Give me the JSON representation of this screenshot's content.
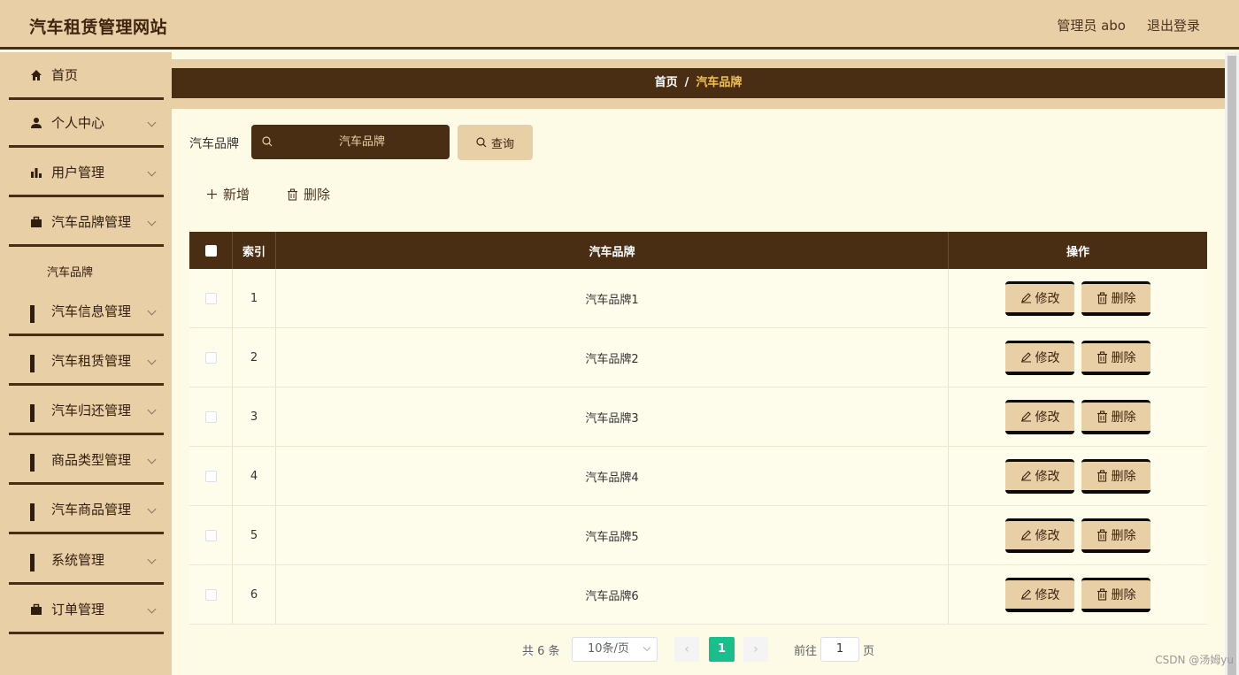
{
  "header": {
    "title": "汽车租赁管理网站",
    "user": "管理员 abo",
    "logout": "退出登录"
  },
  "sidebar": {
    "items": [
      {
        "label": "首页",
        "icon": "home-icon"
      },
      {
        "label": "个人中心",
        "icon": "user-icon"
      },
      {
        "label": "用户管理",
        "icon": "bar-chart-icon"
      },
      {
        "label": "汽车品牌管理",
        "icon": "briefcase-icon"
      },
      {
        "label": "汽车信息管理",
        "icon": "grid-icon"
      },
      {
        "label": "汽车租赁管理",
        "icon": "grid-icon"
      },
      {
        "label": "汽车归还管理",
        "icon": "grid-icon"
      },
      {
        "label": "商品类型管理",
        "icon": "grid-icon"
      },
      {
        "label": "汽车商品管理",
        "icon": "grid-icon"
      },
      {
        "label": "系统管理",
        "icon": "grid-icon"
      },
      {
        "label": "订单管理",
        "icon": "briefcase-icon"
      }
    ],
    "sub_item": "汽车品牌"
  },
  "breadcrumb": {
    "home": "首页",
    "sep": "/",
    "current": "汽车品牌"
  },
  "search": {
    "label": "汽车品牌",
    "placeholder": "汽车品牌",
    "button": "查询"
  },
  "toolbar": {
    "add": "新增",
    "delete": "删除"
  },
  "table": {
    "headers": {
      "index": "索引",
      "brand": "汽车品牌",
      "ops": "操作"
    },
    "rows": [
      {
        "index": "1",
        "brand": "汽车品牌1"
      },
      {
        "index": "2",
        "brand": "汽车品牌2"
      },
      {
        "index": "3",
        "brand": "汽车品牌3"
      },
      {
        "index": "4",
        "brand": "汽车品牌4"
      },
      {
        "index": "5",
        "brand": "汽车品牌5"
      },
      {
        "index": "6",
        "brand": "汽车品牌6"
      }
    ],
    "edit_label": "修改",
    "delete_label": "删除"
  },
  "pagination": {
    "total": "共 6 条",
    "page_size": "10条/页",
    "current": "1",
    "goto_label": "前往",
    "goto_value": "1",
    "page_suffix": "页"
  },
  "watermark": "CSDN @汤姆yu",
  "colors": {
    "accent_dark": "#4a2e14",
    "accent_light": "#e9cfa5",
    "background": "#fdfbe6",
    "active_page": "#19be8d"
  }
}
